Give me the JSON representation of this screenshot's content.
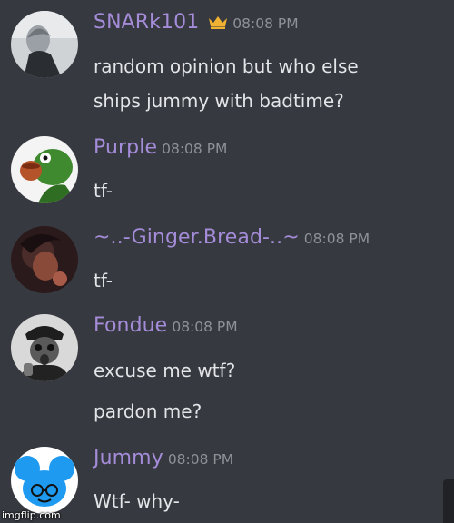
{
  "messages": [
    {
      "username": "SNARk101",
      "timestamp": "08:08 PM",
      "badge": "crown-icon",
      "lines": [
        "random opinion but  who else",
        "ships jummy with badtime?"
      ]
    },
    {
      "username": "Purple",
      "timestamp": "08:08 PM",
      "lines": [
        "tf-"
      ]
    },
    {
      "username": "~..-Ginger.Bread-..~",
      "timestamp": "08:08 PM",
      "lines": [
        "tf-"
      ]
    },
    {
      "username": "Fondue",
      "timestamp": "08:08 PM",
      "lines": [
        "excuse me wtf?",
        "pardon me?"
      ]
    },
    {
      "username": "Jummy",
      "timestamp": "08:08 PM",
      "lines": [
        "Wtf- why-"
      ]
    }
  ],
  "watermark": "imgflip.com",
  "colors": {
    "background": "#36393f",
    "username": "#a58cd9",
    "timestamp": "#8e9297",
    "text": "#e3e5e8",
    "crown": "#f0b232"
  }
}
